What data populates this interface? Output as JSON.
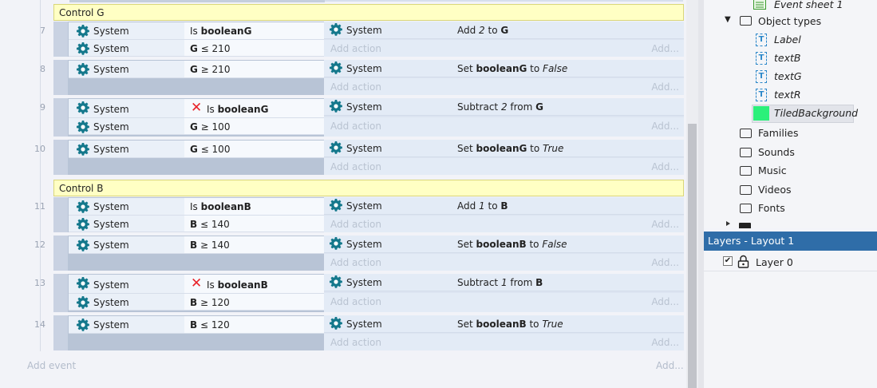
{
  "colors": {
    "group_bg": "#ffffc4",
    "layers_header_bg": "#2f6da8",
    "system_gear": "#14788c",
    "invert_x": "#e8232a",
    "tiledbg_green": "#2bf07a"
  },
  "groups": [
    {
      "label": "Control G"
    },
    {
      "label": "Control B"
    }
  ],
  "events": [
    {
      "num": "7",
      "conditions": [
        {
          "obj": "System",
          "text_pre": "Is ",
          "bold": "booleanG",
          "invert": false
        },
        {
          "obj": "System",
          "text": "G ≤ 210"
        }
      ],
      "actions": [
        {
          "obj": "System",
          "text": "Add 2 to G"
        }
      ]
    },
    {
      "num": "8",
      "conditions": [
        {
          "obj": "System",
          "text": "G ≥ 210"
        }
      ],
      "actions": [
        {
          "obj": "System",
          "text": "Set booleanG to False"
        }
      ]
    },
    {
      "num": "9",
      "conditions": [
        {
          "obj": "System",
          "text_pre": "Is ",
          "bold": "booleanG",
          "invert": true
        },
        {
          "obj": "System",
          "text": "G ≥ 100"
        }
      ],
      "actions": [
        {
          "obj": "System",
          "text": "Subtract 2 from G"
        }
      ]
    },
    {
      "num": "10",
      "conditions": [
        {
          "obj": "System",
          "text": "G ≤ 100"
        }
      ],
      "actions": [
        {
          "obj": "System",
          "text": "Set booleanG to True"
        }
      ]
    },
    {
      "num": "11",
      "conditions": [
        {
          "obj": "System",
          "text_pre": "Is ",
          "bold": "booleanB",
          "invert": false
        },
        {
          "obj": "System",
          "text": "B ≤ 140"
        }
      ],
      "actions": [
        {
          "obj": "System",
          "text": "Add 1 to B"
        }
      ]
    },
    {
      "num": "12",
      "conditions": [
        {
          "obj": "System",
          "text": "B ≥ 140"
        }
      ],
      "actions": [
        {
          "obj": "System",
          "text": "Set booleanB to False"
        }
      ]
    },
    {
      "num": "13",
      "conditions": [
        {
          "obj": "System",
          "text_pre": "Is ",
          "bold": "booleanB",
          "invert": true
        },
        {
          "obj": "System",
          "text": "B ≥ 120"
        }
      ],
      "actions": [
        {
          "obj": "System",
          "text": "Subtract 1 from B"
        }
      ]
    },
    {
      "num": "14",
      "conditions": [
        {
          "obj": "System",
          "text": "B ≤ 120"
        }
      ],
      "actions": [
        {
          "obj": "System",
          "text": "Set booleanB to True"
        }
      ]
    }
  ],
  "labels": {
    "add_action": "Add action",
    "add_more": "Add...",
    "add_event": "Add event"
  },
  "project": {
    "event_sheet": "Event sheet 1",
    "object_types": "Object types",
    "objects": [
      "Label",
      "textB",
      "textG",
      "textR",
      "TiledBackground"
    ],
    "folders": [
      "Families",
      "Sounds",
      "Music",
      "Videos",
      "Fonts"
    ],
    "expand_glyph": "▼"
  },
  "layers": {
    "title": "Layers - Layout 1",
    "items": [
      {
        "name": "Layer 0",
        "visible": true
      }
    ]
  }
}
